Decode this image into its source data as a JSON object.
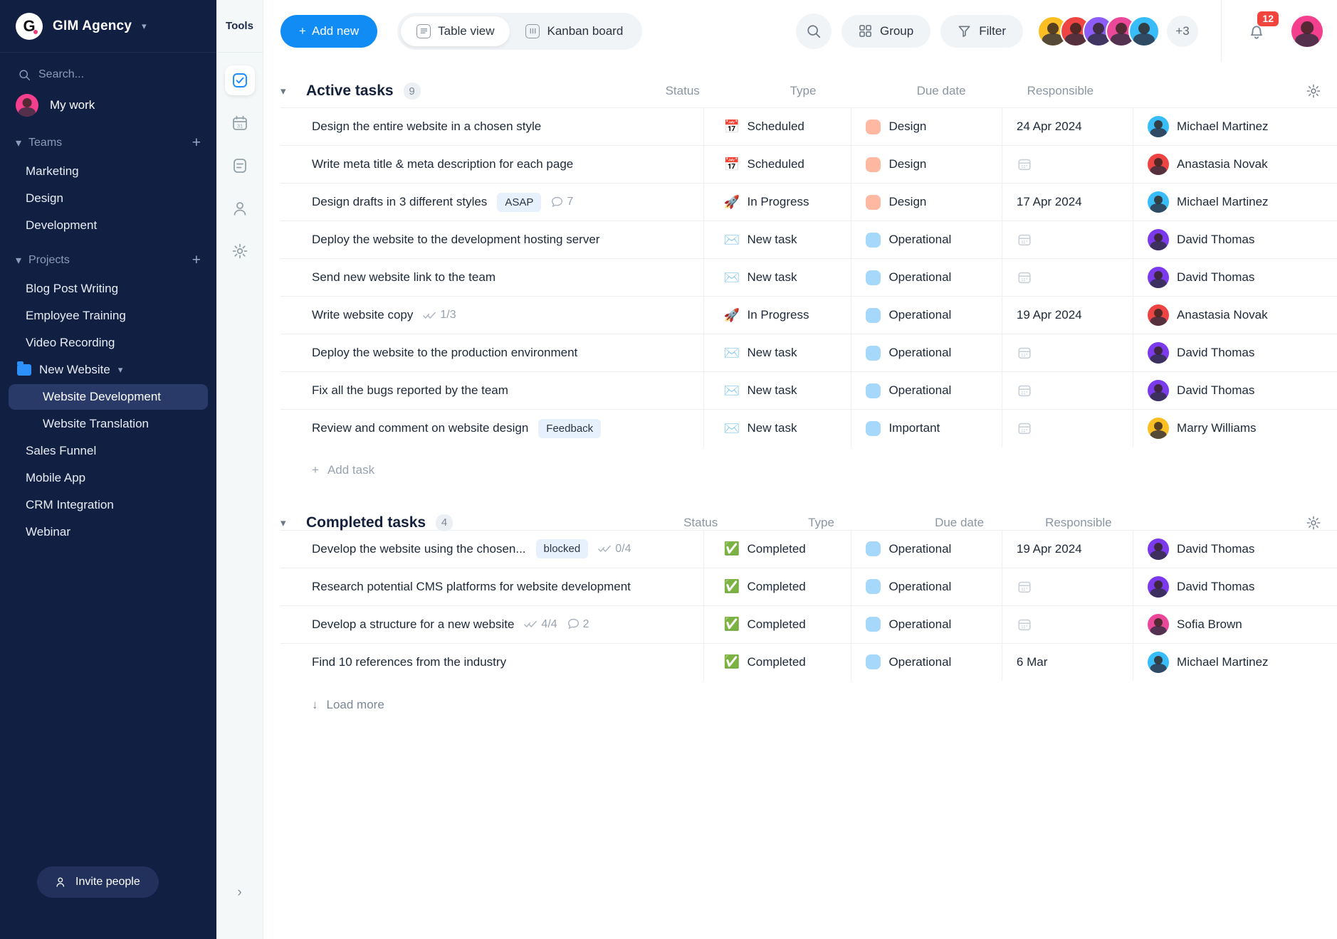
{
  "sidebar": {
    "brand": {
      "logo_letter": "G",
      "name": "GIM Agency",
      "chevron": "chevron-down-icon"
    },
    "search_placeholder": "Search...",
    "my_work_label": "My work",
    "teams": {
      "label": "Teams",
      "add": "+",
      "items": [
        "Marketing",
        "Design",
        "Development"
      ]
    },
    "projects": {
      "label": "Projects",
      "add": "+",
      "items": [
        "Blog Post Writing",
        "Employee Training",
        "Video Recording"
      ],
      "folder": {
        "label": "New Website",
        "children": [
          "Website Development",
          "Website Translation"
        ],
        "active_child": "Website Development"
      },
      "after": [
        "Sales Funnel",
        "Mobile App",
        "CRM Integration",
        "Webinar"
      ]
    },
    "invite_label": "Invite people"
  },
  "rail": {
    "title": "Tools",
    "items": [
      {
        "name": "tasks-icon",
        "active": true
      },
      {
        "name": "calendar-icon",
        "active": false
      },
      {
        "name": "notes-icon",
        "active": false
      },
      {
        "name": "contacts-icon",
        "active": false
      },
      {
        "name": "settings-icon",
        "active": false
      }
    ],
    "expand": "chevron-right-icon"
  },
  "topbar": {
    "add_new_label": "Add new",
    "views": [
      {
        "label": "Table view",
        "selected": true
      },
      {
        "label": "Kanban board",
        "selected": false
      }
    ],
    "search_icon": "search-icon",
    "group_label": "Group",
    "filter_label": "Filter",
    "avatar_overflow": "+3",
    "avatars": [
      "#fbbf24",
      "#ef4444",
      "#8b5cf6",
      "#ec4899",
      "#38bdf8"
    ],
    "notification_count": "12",
    "user_avatar_color": "#f43f8e"
  },
  "columns": {
    "status": "Status",
    "type": "Type",
    "due_date": "Due date",
    "responsible": "Responsible"
  },
  "groups": [
    {
      "title": "Active tasks",
      "count": "9",
      "add_task_label": "Add task",
      "rows": [
        {
          "name": "Design the entire website in a chosen style",
          "chip": null,
          "subtasks": null,
          "comments": null,
          "status": {
            "emoji": "📅",
            "label": "Scheduled"
          },
          "type": {
            "label": "Design",
            "color": "#ffb9a3"
          },
          "due": "24 Apr 2024",
          "responsible": {
            "name": "Michael Martinez",
            "color": "#38bdf8"
          }
        },
        {
          "name": "Write meta title & meta description for each page",
          "chip": null,
          "subtasks": null,
          "comments": null,
          "status": {
            "emoji": "📅",
            "label": "Scheduled"
          },
          "type": {
            "label": "Design",
            "color": "#ffb9a3"
          },
          "due": "",
          "responsible": {
            "name": "Anastasia Novak",
            "color": "#ef4444"
          }
        },
        {
          "name": "Design drafts in 3 different styles",
          "chip": "ASAP",
          "subtasks": null,
          "comments": "7",
          "status": {
            "emoji": "🚀",
            "label": "In Progress"
          },
          "type": {
            "label": "Design",
            "color": "#ffb9a3"
          },
          "due": "17 Apr 2024",
          "responsible": {
            "name": "Michael Martinez",
            "color": "#38bdf8"
          }
        },
        {
          "name": "Deploy the website to the development hosting server",
          "chip": null,
          "subtasks": null,
          "comments": null,
          "status": {
            "emoji": "✉️",
            "label": "New task"
          },
          "type": {
            "label": "Operational",
            "color": "#a5d8fb"
          },
          "due": "",
          "responsible": {
            "name": "David Thomas",
            "color": "#7c3aed"
          }
        },
        {
          "name": "Send new website link to the team",
          "chip": null,
          "subtasks": null,
          "comments": null,
          "status": {
            "emoji": "✉️",
            "label": "New task"
          },
          "type": {
            "label": "Operational",
            "color": "#a5d8fb"
          },
          "due": "",
          "responsible": {
            "name": "David Thomas",
            "color": "#7c3aed"
          }
        },
        {
          "name": "Write website copy",
          "chip": null,
          "subtasks": "1/3",
          "comments": null,
          "status": {
            "emoji": "🚀",
            "label": "In Progress"
          },
          "type": {
            "label": "Operational",
            "color": "#a5d8fb"
          },
          "due": "19 Apr 2024",
          "responsible": {
            "name": "Anastasia Novak",
            "color": "#ef4444"
          }
        },
        {
          "name": "Deploy the website to the production environment",
          "chip": null,
          "subtasks": null,
          "comments": null,
          "status": {
            "emoji": "✉️",
            "label": "New task"
          },
          "type": {
            "label": "Operational",
            "color": "#a5d8fb"
          },
          "due": "",
          "responsible": {
            "name": "David Thomas",
            "color": "#7c3aed"
          }
        },
        {
          "name": "Fix all the bugs reported by the team",
          "chip": null,
          "subtasks": null,
          "comments": null,
          "status": {
            "emoji": "✉️",
            "label": "New task"
          },
          "type": {
            "label": "Operational",
            "color": "#a5d8fb"
          },
          "due": "",
          "responsible": {
            "name": "David Thomas",
            "color": "#7c3aed"
          }
        },
        {
          "name": "Review and comment on website design",
          "chip": "Feedback",
          "subtasks": null,
          "comments": null,
          "status": {
            "emoji": "✉️",
            "label": "New task"
          },
          "type": {
            "label": "Important",
            "color": "#a5d8fb"
          },
          "due": "",
          "responsible": {
            "name": "Marry Williams",
            "color": "#fbbf24"
          }
        }
      ]
    },
    {
      "title": "Completed tasks",
      "count": "4",
      "load_more_label": "Load more",
      "rows": [
        {
          "name": "Develop the website using the chosen...",
          "chip": "blocked",
          "subtasks": "0/4",
          "comments": null,
          "status": {
            "emoji": "✅",
            "label": "Completed"
          },
          "type": {
            "label": "Operational",
            "color": "#a5d8fb"
          },
          "due": "19 Apr 2024",
          "responsible": {
            "name": "David Thomas",
            "color": "#7c3aed"
          }
        },
        {
          "name": "Research potential CMS platforms for website development",
          "chip": null,
          "subtasks": null,
          "comments": null,
          "status": {
            "emoji": "✅",
            "label": "Completed"
          },
          "type": {
            "label": "Operational",
            "color": "#a5d8fb"
          },
          "due": "",
          "responsible": {
            "name": "David Thomas",
            "color": "#7c3aed"
          }
        },
        {
          "name": "Develop a structure for a new website",
          "chip": null,
          "subtasks": "4/4",
          "comments": "2",
          "status": {
            "emoji": "✅",
            "label": "Completed"
          },
          "type": {
            "label": "Operational",
            "color": "#a5d8fb"
          },
          "due": "",
          "responsible": {
            "name": "Sofia Brown",
            "color": "#ec4899"
          }
        },
        {
          "name": "Find 10 references from the industry",
          "chip": null,
          "subtasks": null,
          "comments": null,
          "status": {
            "emoji": "✅",
            "label": "Completed"
          },
          "type": {
            "label": "Operational",
            "color": "#a5d8fb"
          },
          "due": "6 Mar",
          "responsible": {
            "name": "Michael Martinez",
            "color": "#38bdf8"
          }
        }
      ]
    }
  ]
}
